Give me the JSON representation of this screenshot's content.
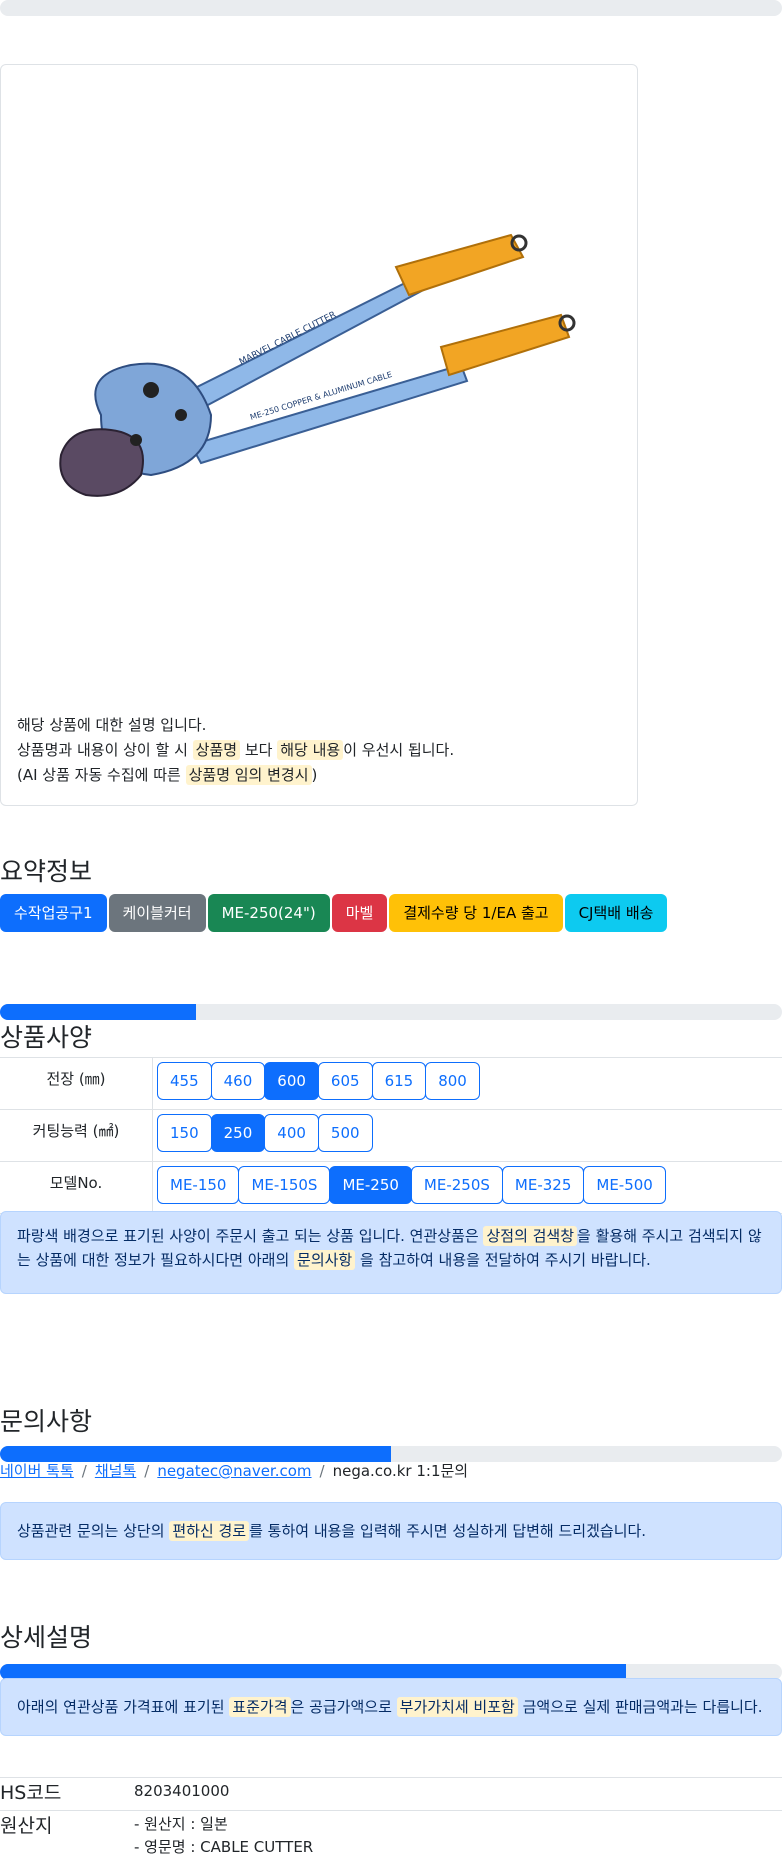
{
  "product_card": {
    "desc_line1": "해당 상품에 대한 설명 입니다.",
    "desc_line2_pre": "상품명과 내용이 상이 할 시",
    "desc_line2_hl1": "상품명",
    "desc_line2_mid": "보다",
    "desc_line2_hl2": "해당 내용",
    "desc_line2_post": "이 우선시 됩니다.",
    "desc_line3_pre": "(AI 상품 자동 수집에 따른",
    "desc_line3_hl": "상품명 임의 변경시",
    "desc_line3_post": ")"
  },
  "cutter_labels": {
    "upper": "MARVEL  CABLE  CUTTER",
    "lower": "ME-250 COPPER & ALUMINUM CABLE"
  },
  "summary": {
    "title": "요약정보",
    "badges": [
      {
        "label": "수작업공구1",
        "color": "#0d6efd"
      },
      {
        "label": "케이블커터",
        "color": "#6c757d"
      },
      {
        "label": "ME-250(24\")",
        "color": "#198754"
      },
      {
        "label": "마벨",
        "color": "#dc3545"
      },
      {
        "label": "결제수량 당 1/EA 출고",
        "color": "#ffc107"
      },
      {
        "label": "CJ택배 배송",
        "color": "#0dcaf0"
      }
    ]
  },
  "spec": {
    "title": "상품사양",
    "progress": 0.25,
    "rows": [
      {
        "label": "전장 (㎜)",
        "options": [
          "455",
          "460",
          "600",
          "605",
          "615",
          "800"
        ],
        "selected": "600"
      },
      {
        "label": "커팅능력 (㎟)",
        "options": [
          "150",
          "250",
          "400",
          "500"
        ],
        "selected": "250"
      },
      {
        "label": "모델No.",
        "options": [
          "ME-150",
          "ME-150S",
          "ME-250",
          "ME-250S",
          "ME-325",
          "ME-500"
        ],
        "selected": "ME-250"
      }
    ],
    "notice_pre": "파랑색 배경으로 표기된 사양이 주문시 출고 되는 상품 입니다. 연관상품은",
    "notice_hl1": "상점의 검색창",
    "notice_mid": "을 활용해 주시고 검색되지 않는 상품에 대한 정보가 필요하시다면 아래의",
    "notice_hl2": "문의사항",
    "notice_post": "을 참고하여 내용을 전달하여 주시기 바랍니다."
  },
  "inquiry": {
    "title": "문의사항",
    "progress": 0.5,
    "links": [
      "네이버 톡톡",
      "채널톡",
      "negatec@naver.com"
    ],
    "sep": "/",
    "last": "nega.co.kr 1:1문의",
    "notice_pre": "상품관련 문의는 상단의",
    "notice_hl": "편하신 경로",
    "notice_post": "를 통하여 내용을 입력해 주시면 성실하게 답변해 드리겠습니다."
  },
  "detail": {
    "title": "상세설명",
    "progress": 0.8,
    "notice_pre": "아래의 연관상품 가격표에 표기된",
    "notice_hl1": "표준가격",
    "notice_mid": "은 공급가액으로",
    "notice_hl2": "부가가치세 비포함",
    "notice_post": "금액으로 실제 판매금액과는 다릅니다.",
    "hs_label": "HS코드",
    "hs_value": "8203401000",
    "origin_label": "원산지",
    "origin_line1": "- 원산지 : 일본",
    "origin_line2": "- 영문명 : CABLE CUTTER"
  }
}
